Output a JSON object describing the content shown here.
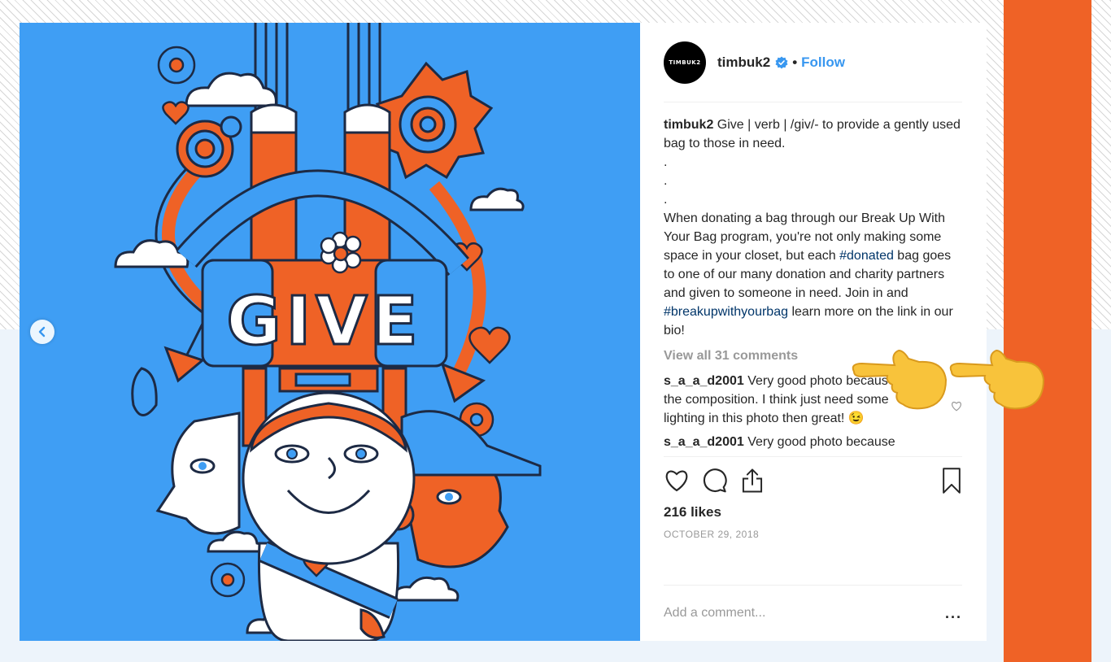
{
  "post": {
    "username": "timbuk2",
    "avatar_text": "TIMBUK2",
    "follow_label": "Follow",
    "separator": "•",
    "artwork_text": "GIVE",
    "caption": {
      "author": "timbuk2",
      "line1": "Give | verb | /giv/- to provide a gently used bag to those in need.",
      "dots": [
        ".",
        ".",
        "."
      ],
      "body_start": "When donating a bag through our Break Up With Your Bag program, you're not only making some space in your closet, but each ",
      "hashtag1": "#donated",
      "body_mid": " bag goes to one of our many donation and charity partners and given to someone in need. Join in and ",
      "hashtag2": "#breakupwithyourbag",
      "body_end": " learn more on the link in our bio!"
    },
    "view_all_comments": "View all 31 comments",
    "comments": [
      {
        "user": "s_a_a_d2001",
        "text": "Very good photo because of the composition. I think just need some lighting in this photo then great! 😉"
      },
      {
        "user": "s_a_a_d2001",
        "text": "Very good photo because"
      }
    ],
    "likes": "216 likes",
    "date": "OCTOBER 29, 2018",
    "add_comment_placeholder": "Add a comment...",
    "more_label": "...",
    "carousel": {
      "count": 2,
      "active_index": 1
    }
  },
  "overlay": {
    "pointer_emoji": "👉"
  },
  "colors": {
    "brand_orange": "#ef6226",
    "artwork_blue": "#3f9ef4",
    "link_blue": "#3897f0",
    "hashtag": "#003569"
  },
  "icons": {
    "prev": "chevron-left-icon",
    "verified": "verified-badge-icon",
    "like": "heart-icon",
    "comment": "comment-bubble-icon",
    "share": "share-icon",
    "save": "bookmark-icon"
  }
}
